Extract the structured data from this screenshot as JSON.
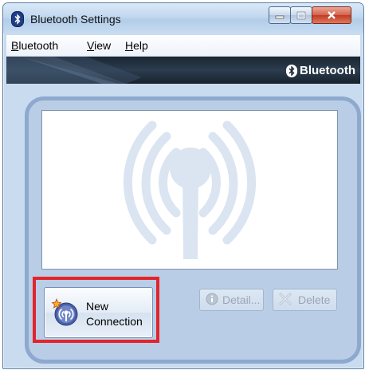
{
  "window": {
    "title": "Bluetooth Settings",
    "controls": {
      "minimize": "—",
      "maximize": "□",
      "close": "✕"
    }
  },
  "menu": [
    {
      "label": "Bluetooth",
      "mnemonic": "B"
    },
    {
      "label": "View",
      "mnemonic": "V"
    },
    {
      "label": "Help",
      "mnemonic": "H"
    }
  ],
  "banner": {
    "brand": "Bluetooth"
  },
  "buttons": {
    "new_connection_line1": "New",
    "new_connection_line2": "Connection",
    "detail": "Detail...",
    "delete": "Delete"
  },
  "icons": {
    "app": "bluetooth-icon",
    "brand": "bluetooth-logo-icon",
    "new_connection": "new-connection-icon",
    "detail": "info-icon",
    "delete": "delete-x-icon",
    "background": "antenna-signal-icon"
  },
  "colors": {
    "highlight": "#e2252b",
    "panel": "#b9cde6",
    "banner": "#1a2531"
  }
}
